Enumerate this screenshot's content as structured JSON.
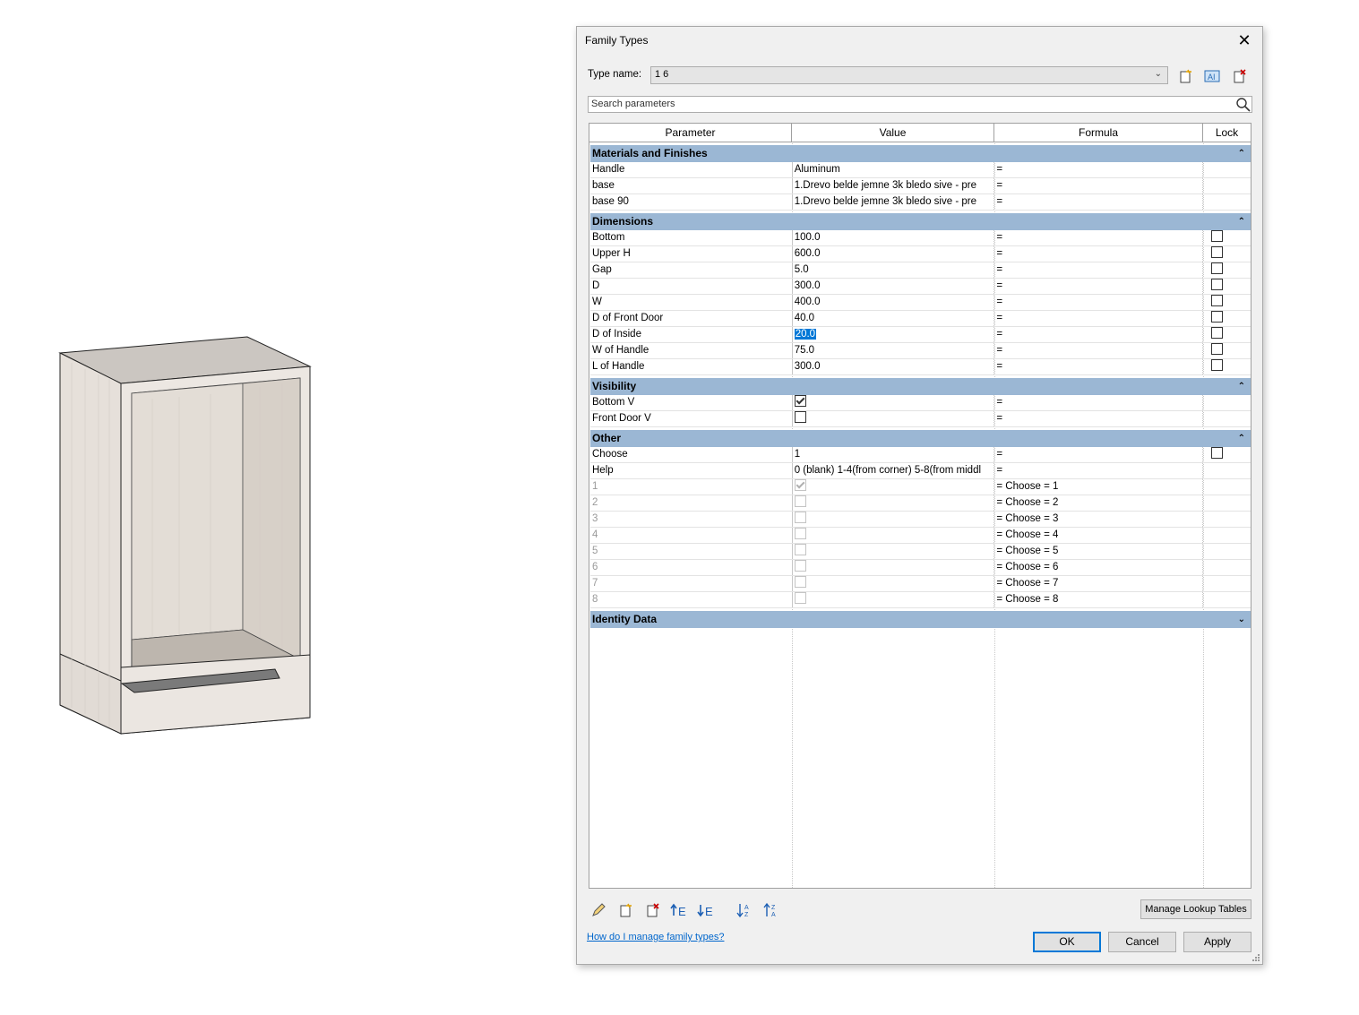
{
  "dialog": {
    "title": "Family Types",
    "type_name_label": "Type name:",
    "type_name_value": "1 6",
    "search_placeholder": "Search parameters"
  },
  "columns": {
    "parameter": "Parameter",
    "value": "Value",
    "formula": "Formula",
    "lock": "Lock"
  },
  "groups": {
    "materials": "Materials and Finishes",
    "dimensions": "Dimensions",
    "visibility": "Visibility",
    "other": "Other",
    "identity": "Identity Data"
  },
  "materials": [
    {
      "param": "Handle",
      "value": "Aluminum",
      "formula": "="
    },
    {
      "param": "base",
      "value": "1.Drevo belde jemne 3k bledo sive - pre",
      "formula": "="
    },
    {
      "param": "base 90",
      "value": "1.Drevo belde jemne 3k bledo sive - pre",
      "formula": "="
    }
  ],
  "dimensions": [
    {
      "param": "Bottom",
      "value": "100.0",
      "formula": "="
    },
    {
      "param": "Upper H",
      "value": "600.0",
      "formula": "="
    },
    {
      "param": "Gap",
      "value": "5.0",
      "formula": "="
    },
    {
      "param": "D",
      "value": "300.0",
      "formula": "="
    },
    {
      "param": "W",
      "value": "400.0",
      "formula": "="
    },
    {
      "param": "D of Front Door",
      "value": "40.0",
      "formula": "="
    },
    {
      "param": "D of Inside",
      "value": "20.0",
      "formula": "="
    },
    {
      "param": "W of Handle",
      "value": "75.0",
      "formula": "="
    },
    {
      "param": "L of Handle",
      "value": "300.0",
      "formula": "="
    }
  ],
  "visibility": [
    {
      "param": "Bottom V",
      "checked": true,
      "formula": "="
    },
    {
      "param": "Front Door V",
      "checked": false,
      "formula": "="
    }
  ],
  "other": [
    {
      "param": "Choose",
      "value": "1",
      "formula": "="
    },
    {
      "param": "Help",
      "value": "0 (blank) 1-4(from corner) 5-8(from middl",
      "formula": "="
    }
  ],
  "choices": [
    {
      "param": "1",
      "checked": true,
      "formula": "= Choose = 1"
    },
    {
      "param": "2",
      "checked": false,
      "formula": "= Choose = 2"
    },
    {
      "param": "3",
      "checked": false,
      "formula": "= Choose = 3"
    },
    {
      "param": "4",
      "checked": false,
      "formula": "= Choose = 4"
    },
    {
      "param": "5",
      "checked": false,
      "formula": "= Choose = 5"
    },
    {
      "param": "6",
      "checked": false,
      "formula": "= Choose = 6"
    },
    {
      "param": "7",
      "checked": false,
      "formula": "= Choose = 7"
    },
    {
      "param": "8",
      "checked": false,
      "formula": "= Choose = 8"
    }
  ],
  "buttons": {
    "manage_lookup": "Manage Lookup Tables",
    "help_link": "How do I manage family types?",
    "ok": "OK",
    "cancel": "Cancel",
    "apply": "Apply"
  },
  "colors": {
    "group_header": "#9bb7d4",
    "selection": "#0078d7",
    "cabinet_wood": "#e8e2dc"
  }
}
